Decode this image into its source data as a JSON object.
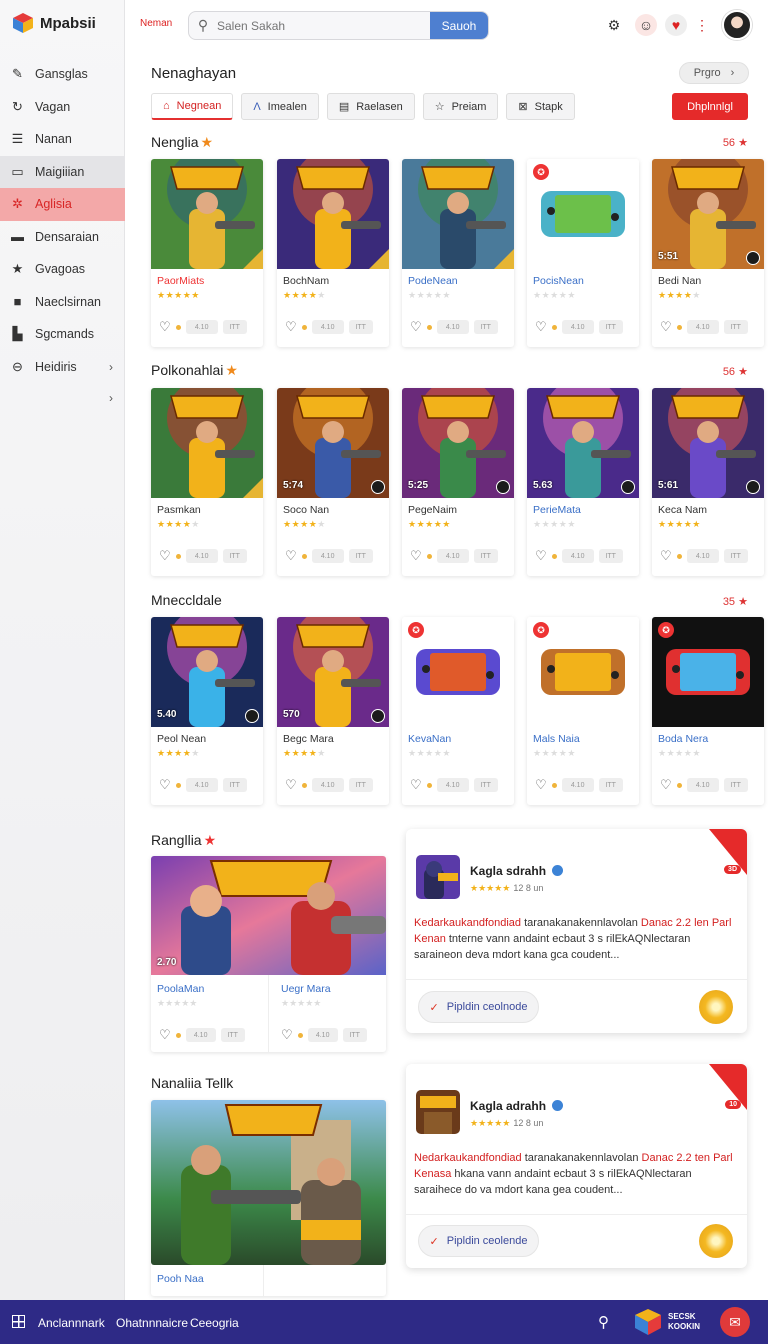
{
  "app": {
    "name": "Mpabsii"
  },
  "topbar": {
    "brand_tag": "Neman",
    "search_placeholder": "Salen Sakah",
    "search_button": "Sauoh"
  },
  "sidebar": {
    "items": [
      {
        "label": "Gansglas",
        "icon": "pencil-icon"
      },
      {
        "label": "Vagan",
        "icon": "refresh-icon"
      },
      {
        "label": "Nanan",
        "icon": "document-icon"
      },
      {
        "label": "Maigiiian",
        "icon": "inbox-icon"
      },
      {
        "label": "Aglisia",
        "icon": "gear-icon"
      },
      {
        "label": "Densaraian",
        "icon": "folder-icon"
      },
      {
        "label": "Gvagoas",
        "icon": "star-icon"
      },
      {
        "label": "Naeclsirnan",
        "icon": "square-icon"
      },
      {
        "label": "Sgcmands",
        "icon": "image-icon"
      },
      {
        "label": "Heidiris",
        "icon": "minus-circle-icon"
      }
    ]
  },
  "main": {
    "title": "Nenaghayan",
    "promo_button": "Prgro",
    "tabs": [
      {
        "label": "Negnean",
        "icon": "bag-icon"
      },
      {
        "label": "Imealen",
        "icon": "a-icon"
      },
      {
        "label": "Raelasen",
        "icon": "list-icon"
      },
      {
        "label": "Preiam",
        "icon": "star-outline-icon"
      },
      {
        "label": "Stapk",
        "icon": "x-box-icon"
      }
    ],
    "cta": "Dhplnnlgl"
  },
  "sections": [
    {
      "title": "Nenglia",
      "count": "56",
      "cards": [
        {
          "name": "PaorMiats",
          "stars": 5,
          "price": "",
          "color": "red"
        },
        {
          "name": "BochNam",
          "stars": 4,
          "price": "",
          "color": ""
        },
        {
          "name": "PodeNean",
          "stars": 0,
          "price": "",
          "color": "blue"
        },
        {
          "name": "PocisNean",
          "stars": 0,
          "price": "",
          "color": "blue"
        },
        {
          "name": "Bedi Nan",
          "stars": 4,
          "price": "5:51",
          "color": ""
        }
      ]
    },
    {
      "title": "Polkonahlai",
      "count": "56",
      "cards": [
        {
          "name": "Pasmkan",
          "stars": 4,
          "price": "",
          "color": ""
        },
        {
          "name": "Soco Nan",
          "stars": 4,
          "price": "5:74",
          "color": ""
        },
        {
          "name": "PegeNaim",
          "stars": 5,
          "price": "5:25",
          "color": ""
        },
        {
          "name": "PerieMata",
          "stars": 0,
          "price": "5.63",
          "color": "blue"
        },
        {
          "name": "Keca Nam",
          "stars": 5,
          "price": "5:61",
          "color": ""
        }
      ]
    },
    {
      "title": "Mneccldale",
      "count": "35",
      "cards": [
        {
          "name": "Peol Nean",
          "stars": 4,
          "price": "5.40",
          "color": ""
        },
        {
          "name": "Begc Mara",
          "stars": 4,
          "price": "570",
          "color": ""
        },
        {
          "name": "KevaNan",
          "stars": 0,
          "price": "",
          "color": "blue"
        },
        {
          "name": "Mals Naia",
          "stars": 0,
          "price": "",
          "color": "blue"
        },
        {
          "name": "Boda Nera",
          "stars": 0,
          "price": "",
          "color": "blue"
        }
      ]
    }
  ],
  "card_pills": [
    "4.10",
    "ITT"
  ],
  "rangila": {
    "title": "Rangllia",
    "price": "2.70",
    "cards": [
      {
        "name": "PoolaMan",
        "stars": 0
      },
      {
        "name": "Uegr Mara",
        "stars": 0
      }
    ]
  },
  "nanalia": {
    "title": "Nanaliia Tellk",
    "card": {
      "name": "Pooh Naa"
    }
  },
  "reviews": [
    {
      "title": "Kagla sdrahh",
      "rating_text": "12 8 un",
      "badge": "3D",
      "text_hl": "Kedarkaukandfondiad",
      "text_a": " taranakanakennlavolan ",
      "text_hl2": "Danac 2.2 len Parl Kenan",
      "text_b": " tnterne vann andaint ecbaut 3 s rilEkAQNlectaran saraineon deva mdort kana gca coudent...",
      "button": "Pipldin ceolnode"
    },
    {
      "title": "Kagla adrahh",
      "rating_text": "12 8 un",
      "badge": "10",
      "text_hl": "Nedarkaukandfondiad",
      "text_a": " taranakanakennlavolan ",
      "text_hl2": "Danac 2.2 ten Parl Kenasa",
      "text_b": " hkana vann andaint ecbaut 3 s rilEkAQNlectaran saraihece do va mdort kana gea coudent...",
      "button": "Pipldin ceolende"
    }
  ],
  "bottombar": {
    "items": [
      "Anclannnark",
      "Ohatnnnaicre",
      "Ceeogria"
    ],
    "brand": "SECSK KOOKIN"
  }
}
